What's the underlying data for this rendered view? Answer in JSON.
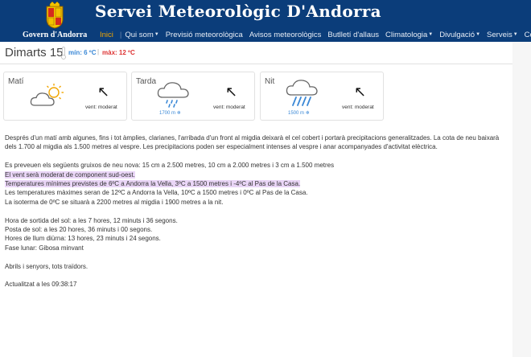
{
  "header": {
    "site_title": "Servei Meteorològic D'Andorra",
    "government": "Govern d'Andorra",
    "colors": {
      "background": "#0b3d7a",
      "active_nav": "#f2a600"
    }
  },
  "nav": {
    "items": [
      {
        "label": "Inici",
        "has_dropdown": false,
        "active": true
      },
      {
        "label": "Qui som",
        "has_dropdown": true
      },
      {
        "label": "Previsió meteorològica",
        "has_dropdown": false
      },
      {
        "label": "Avisos meteorològics",
        "has_dropdown": false
      },
      {
        "label": "Butlletí d'allaus",
        "has_dropdown": false
      },
      {
        "label": "Climatologia",
        "has_dropdown": true
      },
      {
        "label": "Divulgació",
        "has_dropdown": true
      },
      {
        "label": "Serveis",
        "has_dropdown": true
      },
      {
        "label": "Contacte",
        "has_dropdown": false
      }
    ]
  },
  "day": {
    "title": "Dimarts 15",
    "min": "mín: 6 ºC",
    "max": "màx: 12 ºC"
  },
  "periods": [
    {
      "label": "Matí",
      "icon": "partly-cloudy-icon",
      "wind": "vent: moderat",
      "snow_level": ""
    },
    {
      "label": "Tarda",
      "icon": "cloud-rain-icon",
      "wind": "vent: moderat",
      "snow_level": "1700 m"
    },
    {
      "label": "Nit",
      "icon": "cloud-heavy-rain-icon",
      "wind": "vent: moderat",
      "snow_level": "1500 m"
    }
  ],
  "forecast": {
    "p1": "Després d'un matí amb algunes, fins i tot àmplies, clarianes, l'arribada d'un front al migdia deixarà el cel cobert i portarà precipitacions generalitzades. La cota de neu baixarà dels 1.700 al migdia als 1.500 metres al vespre. Les precipitacions poden ser especialment intenses al vespre i anar acompanyades d'activitat elèctrica.",
    "p2": "Es preveuen els següents gruixos de neu nova: 15 cm a 2.500 metres, 10 cm a 2.000 metres i 3 cm a 1.500 metres",
    "wind_line": "El vent serà moderat de component sud-oest.",
    "min_line": "Temperatures mínimes previstes de 6ºC a Andorra la Vella, 3ºC a 1500 metres i -4ºC al Pas de la Casa.",
    "max_line": "Les temperatures màximes seran de 12ºC a Andorra la Vella, 10ºC a 1500 metres i 0ºC al Pas de la Casa.",
    "iso_line": "La isoterma de 0ºC se situarà a 2200 metres al migdia i 1900 metres a la nit.",
    "sunrise": "Hora de sortida del sol: a les 7 hores, 12 minuts i 36 segons.",
    "sunset": "Posta de sol: a les 20 hores, 36 minuts i 00 segons.",
    "daylight": "Hores de llum diürna: 13 hores, 23 minuts i 24 segons.",
    "moon": "Fase lunar: Gibosa minvant",
    "signoff": "Abrils i senyors, tots traïdors.",
    "updated": "Actualitzat a les 09:38:17"
  }
}
